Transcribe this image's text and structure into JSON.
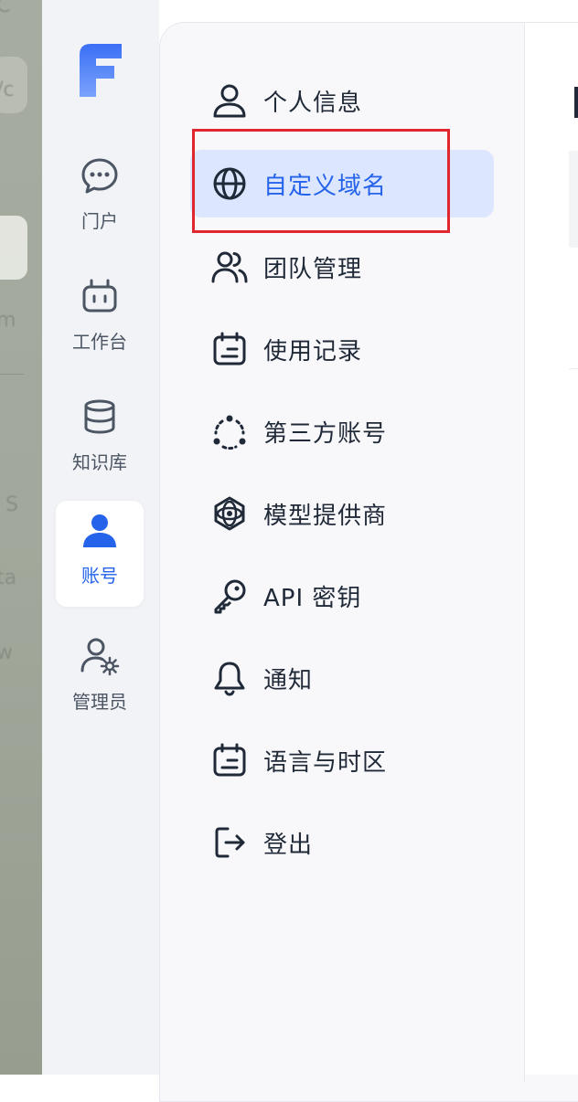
{
  "background_ghost_text": [
    "C",
    "/c",
    "m",
    "S",
    "ta",
    "w"
  ],
  "rail": {
    "items": [
      {
        "label": "门户",
        "icon": "chat-bubble-icon",
        "active": false
      },
      {
        "label": "工作台",
        "icon": "robot-icon",
        "active": false
      },
      {
        "label": "知识库",
        "icon": "database-icon",
        "active": false
      },
      {
        "label": "账号",
        "icon": "user-icon",
        "active": true
      },
      {
        "label": "管理员",
        "icon": "user-gear-icon",
        "active": false
      }
    ]
  },
  "menu": {
    "items": [
      {
        "label": "个人信息",
        "icon": "user-outline-icon",
        "active": false
      },
      {
        "label": "自定义域名",
        "icon": "globe-icon",
        "active": true
      },
      {
        "label": "团队管理",
        "icon": "users-icon",
        "active": false
      },
      {
        "label": "使用记录",
        "icon": "calendar-list-icon",
        "active": false
      },
      {
        "label": "第三方账号",
        "icon": "nodes-icon",
        "active": false
      },
      {
        "label": "模型提供商",
        "icon": "model-atom-icon",
        "active": false
      },
      {
        "label": "API 密钥",
        "icon": "key-icon",
        "active": false
      },
      {
        "label": "通知",
        "icon": "bell-icon",
        "active": false
      },
      {
        "label": "语言与时区",
        "icon": "calendar-list-icon",
        "active": false
      },
      {
        "label": "登出",
        "icon": "logout-icon",
        "active": false
      }
    ]
  },
  "colors": {
    "accent": "#2563eb",
    "active_bg": "#dce7ff",
    "highlight": "#e0262e"
  }
}
